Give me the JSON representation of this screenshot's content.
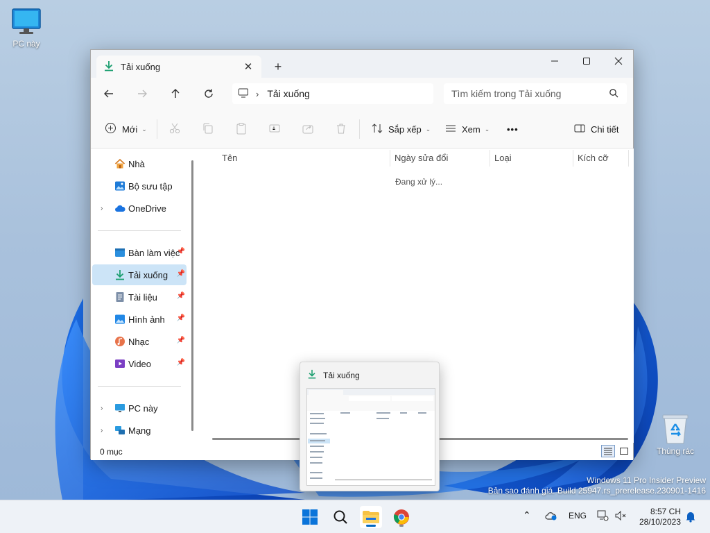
{
  "desktop": {
    "icons": [
      {
        "label": "PC này",
        "icon": "monitor-icon"
      },
      {
        "label": "Thùng rác",
        "icon": "recycle-bin-icon"
      }
    ],
    "watermark": {
      "line1": "Windows 11 Pro Insider Preview",
      "line2": "Bản sao đánh giá. Build 25947.rs_prerelease.230901-1416"
    }
  },
  "window": {
    "tab_title": "Tải xuống",
    "address": "Tải xuống",
    "search_placeholder": "Tìm kiếm trong Tải xuống",
    "toolbar": {
      "new_label": "Mới",
      "sort_label": "Sắp xếp",
      "view_label": "Xem",
      "more_label": "•••",
      "details_label": "Chi tiết"
    },
    "sidebar": {
      "top": [
        {
          "label": "Nhà",
          "icon": "home-icon"
        },
        {
          "label": "Bộ sưu tập",
          "icon": "gallery-icon"
        },
        {
          "label": "OneDrive",
          "icon": "onedrive-cloud-icon",
          "expandable": true
        }
      ],
      "pinned": [
        {
          "label": "Bàn làm việc",
          "icon": "desktop-folder-icon"
        },
        {
          "label": "Tải xuống",
          "icon": "download-icon",
          "active": true
        },
        {
          "label": "Tài liệu",
          "icon": "documents-icon"
        },
        {
          "label": "Hình ảnh",
          "icon": "pictures-icon"
        },
        {
          "label": "Nhạc",
          "icon": "music-icon"
        },
        {
          "label": "Video",
          "icon": "video-icon"
        }
      ],
      "bottom": [
        {
          "label": "PC này",
          "icon": "monitor-icon",
          "expandable": true
        },
        {
          "label": "Mạng",
          "icon": "network-icon",
          "expandable": true
        }
      ]
    },
    "columns": [
      "Tên",
      "Ngày sửa đổi",
      "Loại",
      "Kích cỡ"
    ],
    "loading_text": "Đang xử lý...",
    "status_text": "0 mục"
  },
  "thumbnail": {
    "title": "Tải xuống"
  },
  "taskbar": {
    "lang": "ENG",
    "time": "8:57 CH",
    "date": "28/10/2023"
  },
  "colors": {
    "accent": "#0067c0",
    "selected": "#cce4f7",
    "download_green": "#1a9e6f"
  }
}
